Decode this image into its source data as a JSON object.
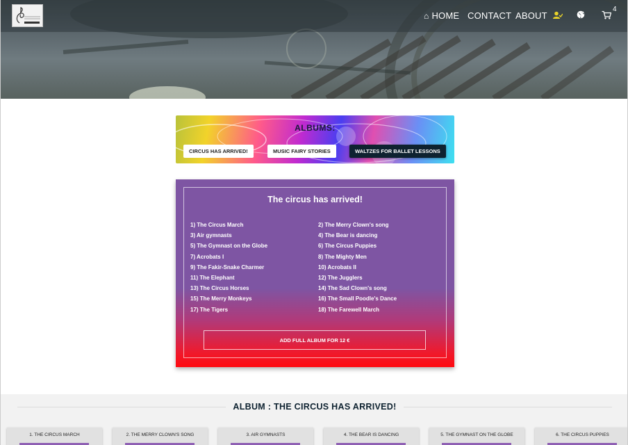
{
  "nav": {
    "home": "HOME",
    "contact": "CONTACT",
    "about": "ABOUT",
    "cart_count": "4",
    "icons": [
      "home-icon",
      "user-check-icon",
      "globe-icon",
      "chevron-down-icon",
      "cart-icon"
    ]
  },
  "albums": {
    "title": "ALBUMS:",
    "buttons": [
      "CIRCUS HAS ARRIVED!",
      "MUSIC FAIRY STORIES",
      "WALTZES FOR BALLET LESSONS"
    ]
  },
  "tracklist": {
    "title": "The circus has arrived!",
    "tracks": [
      "1) The Circus March",
      "2) The Merry Clown's song",
      "3) Air gymnasts",
      "4) The Bear is dancing",
      "5) The Gymnast on the Globe",
      "6) The Circus Puppies",
      "7) Acrobats I",
      "8) The Mighty Men",
      "9) The Fakir-Snake Charmer",
      "10) Acrobats II",
      "11) The Elephant",
      "12) The Jugglers",
      "13) The Circus Horses",
      "14) The Sad Clown's song",
      "15) The Merry Monkeys",
      "16) The Small Poodle's Dance",
      "17) The Tigers",
      "18) The Farewell March"
    ],
    "add_button": "ADD FULL ALBUM FOR 12 €"
  },
  "album_section": {
    "title": "ALBUM : THE CIRCUS HAS ARRIVED!",
    "songs": [
      "1. THE CIRCUS MARCH",
      "2. THE MERRY CLOWN'S SONG",
      "3. AIR GYMNASTS",
      "4. THE BEAR IS DANCING",
      "5. THE GYMNAST ON THE GLOBE",
      "6. THE CIRCUS PUPPIES"
    ]
  },
  "colors": {
    "accent_purple": "#7e55a3",
    "accent_red": "#ff0a10",
    "dark_navy": "#0e2230",
    "user_icon": "#e8d22a"
  }
}
